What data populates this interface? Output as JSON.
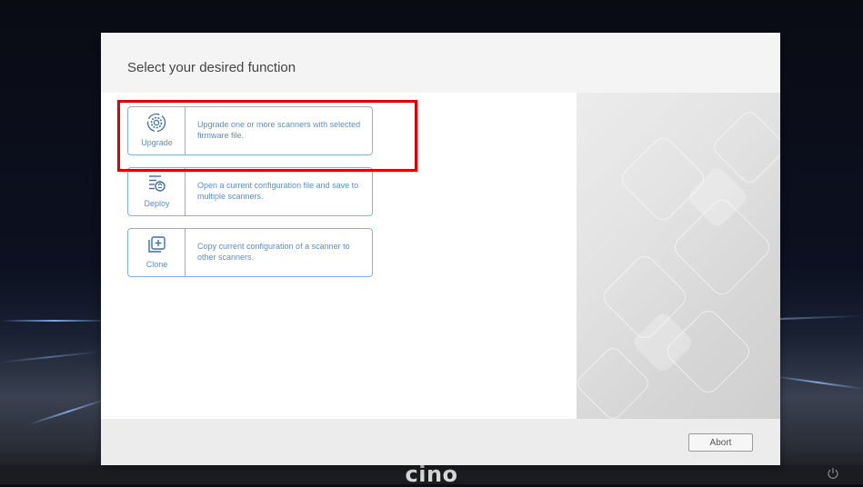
{
  "dialog": {
    "title": "Select your desired function"
  },
  "functions": [
    {
      "label": "Upgrade",
      "description": "Upgrade one or more scanners with selected firmware file.",
      "icon": "gear-cycle-icon"
    },
    {
      "label": "Deploy",
      "description": "Open a current configuration file and save to multiple scanners.",
      "icon": "config-deploy-icon"
    },
    {
      "label": "Clone",
      "description": "Copy current configuration of a scanner to other scanners.",
      "icon": "clone-add-icon"
    }
  ],
  "footer": {
    "abort_label": "Abort"
  },
  "brand": {
    "logo_text": "cino"
  },
  "colors": {
    "accent": "#5a8ec8",
    "highlight": "#e00000"
  }
}
